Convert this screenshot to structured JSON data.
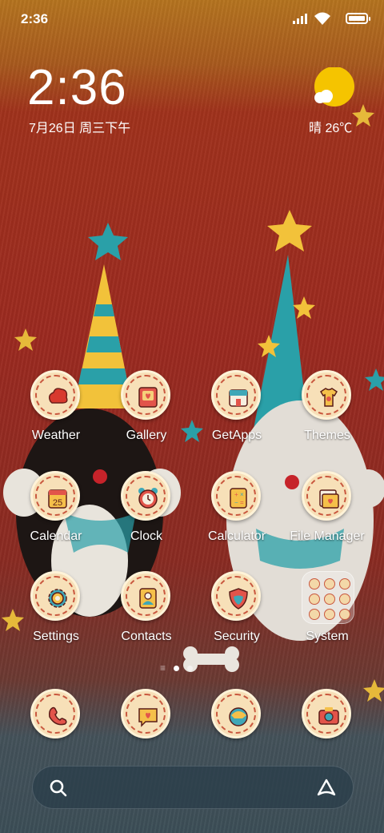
{
  "status_bar": {
    "time": "2:36"
  },
  "clock_widget": {
    "time": "2:36",
    "date": "7月26日 周三下午"
  },
  "weather_widget": {
    "text": "晴 26℃",
    "icon": "sun-cloud-icon"
  },
  "apps": [
    {
      "label": "Weather",
      "icon": "weather-icon"
    },
    {
      "label": "Gallery",
      "icon": "gallery-icon"
    },
    {
      "label": "GetApps",
      "icon": "store-icon"
    },
    {
      "label": "Themes",
      "icon": "themes-icon"
    },
    {
      "label": "Calendar",
      "icon": "calendar-icon",
      "badge": "25"
    },
    {
      "label": "Clock",
      "icon": "alarm-clock-icon"
    },
    {
      "label": "Calculator",
      "icon": "calculator-icon"
    },
    {
      "label": "File Manager",
      "icon": "folder-icon"
    },
    {
      "label": "Settings",
      "icon": "gear-icon"
    },
    {
      "label": "Contacts",
      "icon": "contacts-icon"
    },
    {
      "label": "Security",
      "icon": "shield-icon"
    },
    {
      "label": "System",
      "icon": "folder-grid-icon"
    }
  ],
  "dock": [
    {
      "icon": "phone-icon"
    },
    {
      "icon": "message-icon"
    },
    {
      "icon": "browser-icon"
    },
    {
      "icon": "camera-icon"
    }
  ],
  "page_indicator": {
    "pages": 2,
    "current": 1
  },
  "colors": {
    "accent": "#c9583f",
    "icon_bg": "#f7e0b8",
    "sun": "#f5c400"
  }
}
